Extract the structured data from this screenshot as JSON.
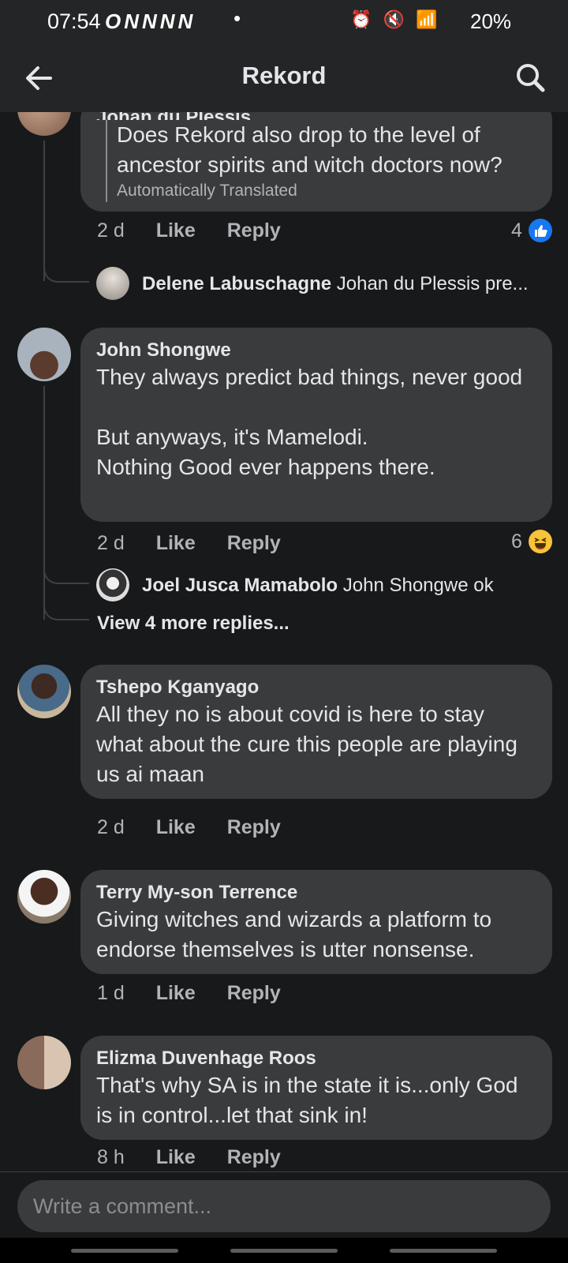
{
  "status_bar": {
    "time": "07:54",
    "notification_icons": "ONNNN",
    "dot": "•",
    "system_icons": "⏰ 🔇 📶",
    "battery": "20%"
  },
  "header": {
    "title": "Rekord",
    "back_icon": "back-arrow-icon",
    "search_icon": "search-icon"
  },
  "comments": [
    {
      "author": "Johan du Plessis",
      "text": "Does Rekord also drop to the level of ancestor spirits and witch doctors now?",
      "translation_note": "Automatically Translated",
      "time": "2 d",
      "like_label": "Like",
      "reply_label": "Reply",
      "reaction_count": "4",
      "reaction_type": "like",
      "replies": [
        {
          "author": "Delene Labuschagne",
          "text": "Johan du Plessis pre..."
        }
      ]
    },
    {
      "author": "John Shongwe",
      "text": "They always predict bad things, never good\n\nBut anyways, it's Mamelodi.\nNothing Good ever happens there.",
      "time": "2 d",
      "like_label": "Like",
      "reply_label": "Reply",
      "reaction_count": "6",
      "reaction_type": "haha",
      "replies": [
        {
          "author": "Joel Jusca Mamabolo",
          "text": "John Shongwe ok"
        }
      ],
      "view_more": "View 4 more replies..."
    },
    {
      "author": "Tshepo Kganyago",
      "text": "All they no is about covid is here to stay what about the cure this people are playing us ai maan",
      "time": "2 d",
      "like_label": "Like",
      "reply_label": "Reply"
    },
    {
      "author": "Terry My-son Terrence",
      "text": "Giving witches and wizards a platform to endorse themselves is utter nonsense.",
      "time": "1 d",
      "like_label": "Like",
      "reply_label": "Reply"
    },
    {
      "author": "Elizma Duvenhage Roos",
      "text": "That's why SA is in the state it is...only God is in control...let that sink in!",
      "time": "8 h",
      "like_label": "Like",
      "reply_label": "Reply"
    }
  ],
  "composer": {
    "placeholder": "Write a comment..."
  },
  "colors": {
    "background": "#18191a",
    "bubble": "#3a3b3c",
    "secondary_text": "#b0b3b8",
    "like_blue": "#1877f2",
    "haha_yellow": "#f7c33a"
  }
}
